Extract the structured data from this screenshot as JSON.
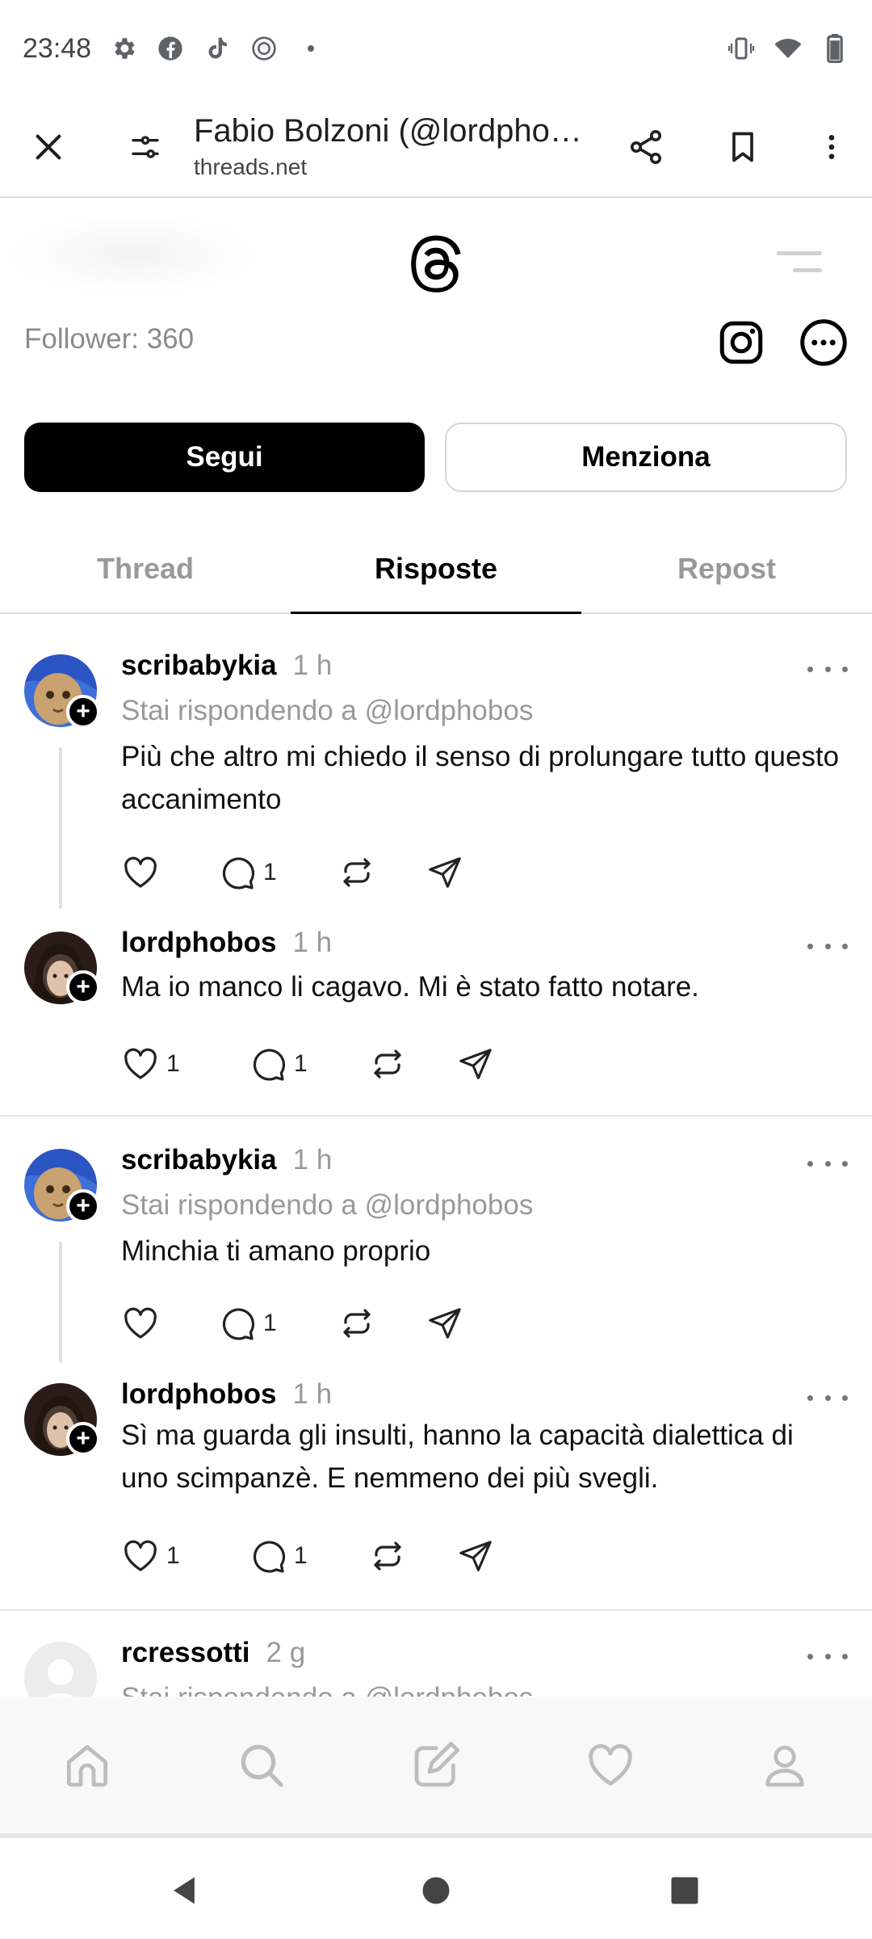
{
  "status_bar": {
    "time": "23:48"
  },
  "browser": {
    "title": "Fabio Bolzoni (@lordphobos) …",
    "url": "threads.net"
  },
  "profile": {
    "followers": "Follower: 360",
    "follow_label": "Segui",
    "mention_label": "Menziona"
  },
  "tabs": [
    {
      "label": "Thread",
      "active": false
    },
    {
      "label": "Risposte",
      "active": true
    },
    {
      "label": "Repost",
      "active": false
    }
  ],
  "posts": [
    {
      "username": "scribabykia",
      "time": "1 h",
      "reply_to": "Stai rispondendo a @lordphobos",
      "text": "Più che altro mi chiedo il senso di prolungare tutto questo accanimento",
      "likes": "",
      "comments": "1"
    },
    {
      "username": "lordphobos",
      "time": "1 h",
      "text": "Ma io manco li cagavo. Mi è stato fatto notare.",
      "likes": "1",
      "comments": "1"
    },
    {
      "username": "scribabykia",
      "time": "1 h",
      "reply_to": "Stai rispondendo a @lordphobos",
      "text": "Minchia ti amano proprio",
      "likes": "",
      "comments": "1"
    },
    {
      "username": "lordphobos",
      "time": "1 h",
      "text": "Sì ma guarda gli insulti, hanno la capacità dialettica di uno scimpanzè. E nemmeno dei più svegli.",
      "likes": "1",
      "comments": "1"
    },
    {
      "username": "rcressotti",
      "time": "2 g",
      "reply_to": "Stai rispondendo a @lordphobos"
    }
  ],
  "icons": {
    "close": "close-icon",
    "site_settings": "tune-icon",
    "share": "share-icon",
    "bookmark": "bookmark-icon",
    "menu": "more-vertical-icon",
    "threads_logo": "threads-logo-icon",
    "instagram": "instagram-icon"
  },
  "colors": {
    "primary": "#000000",
    "muted_text": "#999999",
    "divider": "#e6e6e6"
  }
}
